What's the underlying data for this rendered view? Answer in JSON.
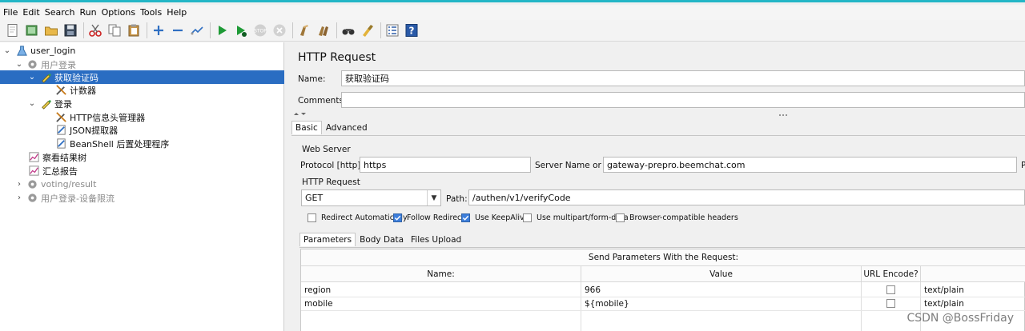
{
  "menu": [
    {
      "name": "file",
      "label": "File"
    },
    {
      "name": "edit",
      "label": "Edit"
    },
    {
      "name": "search",
      "label": "Search"
    },
    {
      "name": "run",
      "label": "Run"
    },
    {
      "name": "options",
      "label": "Options"
    },
    {
      "name": "tools",
      "label": "Tools"
    },
    {
      "name": "help",
      "label": "Help"
    }
  ],
  "toolbar_icons": [
    "new-icon",
    "templates-icon",
    "open-icon",
    "save-icon",
    "cut-icon",
    "copy-icon",
    "paste-icon",
    "expand-icon",
    "collapse-icon",
    "toggle-icon",
    "start-icon",
    "start-no-pause-icon",
    "stop-icon",
    "shutdown-icon",
    "clear-icon",
    "clear-all-icon",
    "search-icon",
    "reset-search-icon",
    "function-helper-icon",
    "help-icon"
  ],
  "tree": {
    "root": "user_login",
    "tg1": "用户登录",
    "sampler1": "获取验证码",
    "counter": "计数器",
    "sampler2": "登录",
    "header_mgr": "HTTP信息头管理器",
    "json_extractor": "JSON提取器",
    "beanshell": "BeanShell 后置处理程序",
    "result_tree": "察看结果树",
    "summary": "汇总报告",
    "tg2": "voting/result",
    "tg3": "用户登录-设备限流"
  },
  "panel": {
    "title": "HTTP Request",
    "name_label": "Name:",
    "name_value": "获取验证码",
    "comments_label": "Comments:",
    "comments_value": "",
    "tab_basic": "Basic",
    "tab_advanced": "Advanced",
    "web_server_title": "Web Server",
    "protocol_label": "Protocol [http]:",
    "protocol_value": "https",
    "server_label": "Server Name or IP:",
    "server_value": "gateway-prepro.beemchat.com",
    "port_label_cut": "P",
    "http_request_title": "HTTP Request",
    "method_value": "GET",
    "path_label": "Path:",
    "path_value": "/authen/v1/verifyCode",
    "checkboxes": [
      {
        "label": "Redirect Automatically",
        "checked": false
      },
      {
        "label": "Follow Redirects",
        "checked": true
      },
      {
        "label": "Use KeepAlive",
        "checked": true
      },
      {
        "label": "Use multipart/form-data",
        "checked": false
      },
      {
        "label": "Browser-compatible headers",
        "checked": false
      }
    ],
    "subtab_params": "Parameters",
    "subtab_body": "Body Data",
    "subtab_files": "Files Upload"
  },
  "params_table": {
    "caption": "Send Parameters With the Request:",
    "col_name": "Name:",
    "col_value": "Value",
    "col_encode": "URL Encode?",
    "rows": [
      {
        "name": "region",
        "value": "966",
        "encode": false,
        "content_type": "text/plain"
      },
      {
        "name": "mobile",
        "value": "${mobile}",
        "encode": false,
        "content_type": "text/plain"
      }
    ]
  },
  "watermark": "CSDN @BossFriday"
}
